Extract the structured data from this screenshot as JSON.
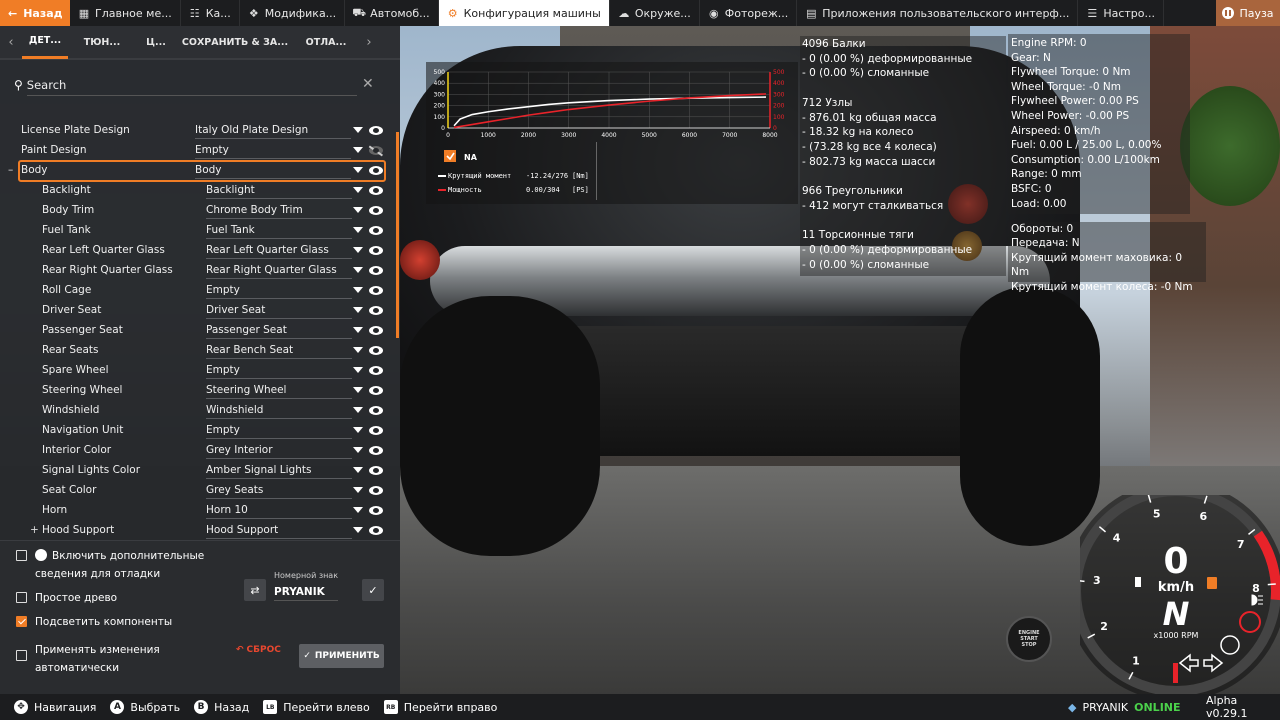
{
  "topbar": {
    "back_label": "Назад",
    "tabs": [
      {
        "label": "Главное ме...",
        "icon": "grid-icon"
      },
      {
        "label": "Ка...",
        "icon": "map-icon"
      },
      {
        "label": "Модифика...",
        "icon": "puzzle-icon"
      },
      {
        "label": "Автомоб...",
        "icon": "car-icon"
      },
      {
        "label": "Конфигурация машины",
        "icon": "car-config-icon",
        "active": true
      },
      {
        "label": "Окруже...",
        "icon": "weather-icon"
      },
      {
        "label": "Фотореж...",
        "icon": "camera-icon"
      },
      {
        "label": "Приложения пользовательского интерф...",
        "icon": "ui-apps-icon"
      },
      {
        "label": "Настро...",
        "icon": "sliders-icon"
      }
    ],
    "pause_label": "Пауза"
  },
  "subtabs": [
    "ДЕТ...",
    "ТЮН...",
    "Ц...",
    "СОХРАНИТЬ & ЗА...",
    "ОТЛА..."
  ],
  "search": {
    "placeholder": "Search",
    "value": ""
  },
  "parts": [
    {
      "name": "License Plate Design",
      "value": "Italy Old Plate Design",
      "level": 0,
      "visible": true
    },
    {
      "name": "Paint Design",
      "value": "Empty",
      "level": 0,
      "visible": false
    },
    {
      "name": "Body",
      "value": "Body",
      "level": 0,
      "visible": true,
      "highlighted": true,
      "expanded": true
    },
    {
      "name": "Backlight",
      "value": "Backlight",
      "level": 1,
      "visible": true
    },
    {
      "name": "Body Trim",
      "value": "Chrome Body Trim",
      "level": 1,
      "visible": true
    },
    {
      "name": "Fuel Tank",
      "value": "Fuel Tank",
      "level": 1,
      "visible": true
    },
    {
      "name": "Rear Left Quarter Glass",
      "value": "Rear Left Quarter Glass",
      "level": 1,
      "visible": true
    },
    {
      "name": "Rear Right Quarter Glass",
      "value": "Rear Right Quarter Glass",
      "level": 1,
      "visible": true
    },
    {
      "name": "Roll Cage",
      "value": "Empty",
      "level": 1,
      "visible": true
    },
    {
      "name": "Driver Seat",
      "value": "Driver Seat",
      "level": 1,
      "visible": true
    },
    {
      "name": "Passenger Seat",
      "value": "Passenger Seat",
      "level": 1,
      "visible": true
    },
    {
      "name": "Rear Seats",
      "value": "Rear Bench Seat",
      "level": 1,
      "visible": true
    },
    {
      "name": "Spare Wheel",
      "value": "Empty",
      "level": 1,
      "visible": true
    },
    {
      "name": "Steering Wheel",
      "value": "Steering Wheel",
      "level": 1,
      "visible": true
    },
    {
      "name": "Windshield",
      "value": "Windshield",
      "level": 1,
      "visible": true
    },
    {
      "name": "Navigation Unit",
      "value": "Empty",
      "level": 1,
      "visible": true
    },
    {
      "name": "Interior Color",
      "value": "Grey Interior",
      "level": 1,
      "visible": true
    },
    {
      "name": "Signal Lights Color",
      "value": "Amber Signal Lights",
      "level": 1,
      "visible": true
    },
    {
      "name": "Seat Color",
      "value": "Grey Seats",
      "level": 1,
      "visible": true
    },
    {
      "name": "Horn",
      "value": "Horn 10",
      "level": 1,
      "visible": true
    },
    {
      "name": "Hood Support",
      "value": "Hood Support",
      "level": 1,
      "visible": true,
      "collapsed": true
    }
  ],
  "options": {
    "debug_info": {
      "label": "Включить дополнительные сведения для отладки",
      "checked": false
    },
    "simple_tree": {
      "label": "Простое древо",
      "checked": false
    },
    "highlight_parts": {
      "label": "Подсветить компоненты",
      "checked": true
    },
    "auto_apply": {
      "label": "Применять изменения автоматически",
      "checked": false
    },
    "plate_label": "Номерной знак",
    "plate_value": "PRYANIK",
    "reset_label": "СБРОС",
    "apply_label": "ПРИМЕНИТЬ"
  },
  "bottombar": {
    "hints": [
      {
        "key": "nav-icon",
        "label": "Навигация"
      },
      {
        "key": "A",
        "label": "Выбрать"
      },
      {
        "key": "B",
        "label": "Назад"
      },
      {
        "key": "LB",
        "label": "Перейти влево"
      },
      {
        "key": "RB",
        "label": "Перейти вправо"
      }
    ],
    "username": "PRYANIK",
    "status": "ONLINE",
    "version": "Alpha v0.29.1"
  },
  "stats": [
    "4096 Балки",
    "- 0 (0.00 %) деформированные",
    "- 0 (0.00 %) сломанные",
    "",
    "712 Узлы",
    "- 876.01 kg общая масса",
    "- 18.32 kg на колесо",
    "- (73.28 kg все 4 колеса)",
    "- 802.73 kg масса шасси",
    "",
    "966 Треугольники",
    "- 412 могут сталкиваться",
    "",
    "11 Торсионные тяги",
    "- 0 (0.00 %) деформированные",
    "- 0 (0.00 %) сломанные"
  ],
  "engine_info": [
    "Engine RPM: 0",
    "Gear: N",
    "Flywheel Torque: 0 Nm",
    "Wheel Torque: -0 Nm",
    "Flywheel Power: 0.00 PS",
    "Wheel Power: -0.00 PS",
    "Airspeed: 0 km/h",
    "Fuel: 0.00 L / 25.00 L, 0.00%",
    "Consumption: 0.00 L/100km",
    "Range: 0 mm",
    "BSFC: 0",
    "Load: 0.00"
  ],
  "drivetrain_info": [
    "Обороты: 0",
    "Передача: N",
    "Крутящий момент маховика: 0 Nm",
    "Крутящий момент колеса: -0 Nm"
  ],
  "chart_data": {
    "type": "line",
    "title": "",
    "xlabel": "",
    "ylabel": "",
    "x_ticks": [
      0,
      1000,
      2000,
      3000,
      4000,
      5000,
      6000,
      7000,
      8000
    ],
    "y_left_ticks": [
      0,
      100,
      200,
      300,
      400,
      500
    ],
    "y_right_ticks": [
      0,
      100,
      200,
      300,
      400,
      500
    ],
    "xlim": [
      0,
      8000
    ],
    "ylim": [
      0,
      500
    ],
    "series": [
      {
        "name": "Крутящий момент",
        "color": "#ffffff",
        "x": [
          150,
          300,
          600,
          1000,
          1500,
          2000,
          2500,
          3000,
          4000,
          5000,
          6000,
          7000,
          7900
        ],
        "y": [
          20,
          80,
          120,
          145,
          170,
          190,
          210,
          225,
          245,
          258,
          266,
          272,
          276
        ]
      },
      {
        "name": "Мощность",
        "color": "#e8232a",
        "x": [
          150,
          500,
          1000,
          1500,
          2000,
          2500,
          3000,
          4000,
          5000,
          6000,
          7000,
          7900
        ],
        "y": [
          5,
          25,
          55,
          85,
          115,
          140,
          165,
          205,
          240,
          268,
          290,
          304
        ]
      }
    ],
    "legend": {
      "label": "NA",
      "checked": true,
      "rows": [
        {
          "name": "Крутящий момент",
          "value": "-12.24/276",
          "unit": "[Nm]",
          "color": "#ffffff"
        },
        {
          "name": "Мощность",
          "value": "0.00/304",
          "unit": "[PS]",
          "color": "#e8232a"
        }
      ]
    },
    "left_axis_color": "#f2d31b",
    "right_axis_color": "#e8232a"
  },
  "gauge": {
    "speed": "0",
    "unit": "km/h",
    "gear": "N",
    "rpm_unit": "x1000 RPM",
    "rpm_ticks": [
      "1",
      "2",
      "3",
      "4",
      "5",
      "6",
      "7",
      "8"
    ],
    "start_stop_label": "ENGINE START STOP",
    "accent": "#e8232a"
  }
}
